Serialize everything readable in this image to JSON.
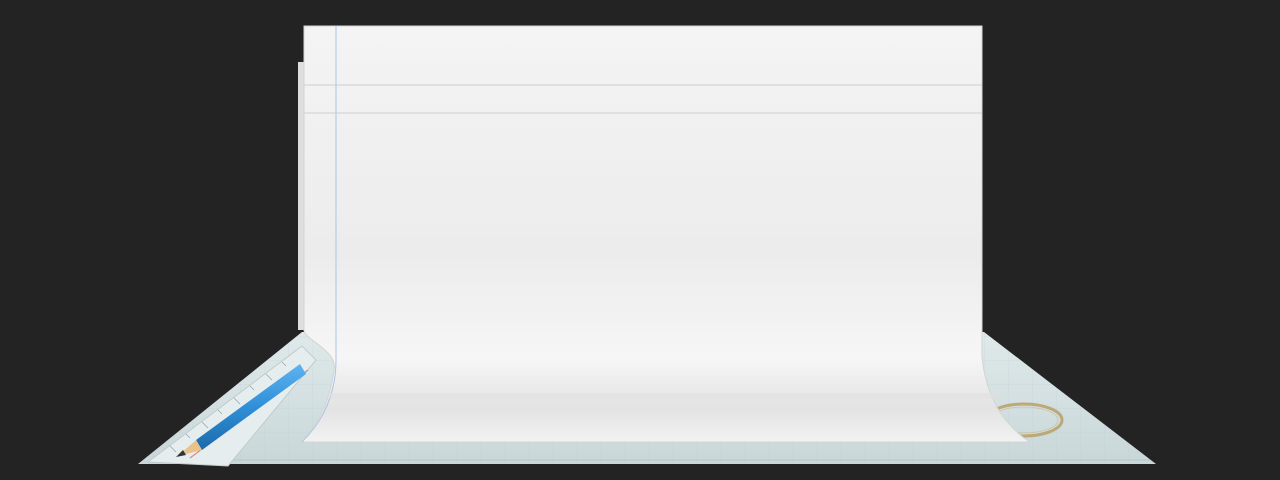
{
  "scene": {
    "background_color": "#232323",
    "description_items": [
      "desk-mat",
      "ruler",
      "pencil",
      "curled-paper-sheet",
      "coffee-ring-stain"
    ]
  },
  "colors": {
    "paper": "#f1f1f1",
    "paper_shadow": "#dcdcdc",
    "mat": "#d6e2e3",
    "mat_grid": "#b9cbcd",
    "ruler": "#e8eef0",
    "pencil_body": "#2f8fd8",
    "pencil_wood": "#e8c28a",
    "pencil_lead": "#333333",
    "margin_line": "#a9c4e4",
    "header_line": "#cfcfcf",
    "coffee_stain": "#b9a065",
    "ruler_red_line": "#d9716a"
  }
}
